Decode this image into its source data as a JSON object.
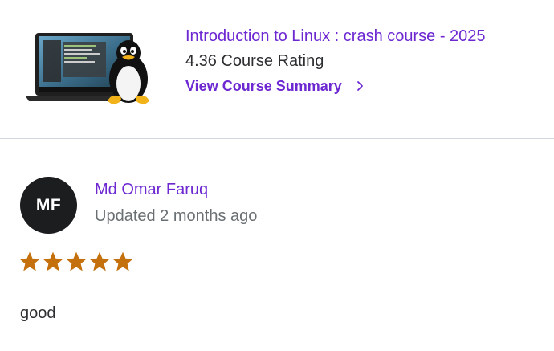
{
  "course": {
    "title": "Introduction to Linux : crash course - 2025",
    "rating_text": "4.36 Course Rating",
    "summary_link_label": "View Course Summary",
    "summary_link_icon": "chevron-right-icon",
    "thumbnail_icon": "linux-penguin-laptop-image",
    "accent_color": "#6d28d2"
  },
  "review": {
    "avatar_initials": "MF",
    "reviewer_name": "Md Omar Faruq",
    "updated_text": "Updated 2 months ago",
    "star_rating": 5,
    "star_max": 5,
    "star_color": "#c4710d",
    "body": "good"
  }
}
